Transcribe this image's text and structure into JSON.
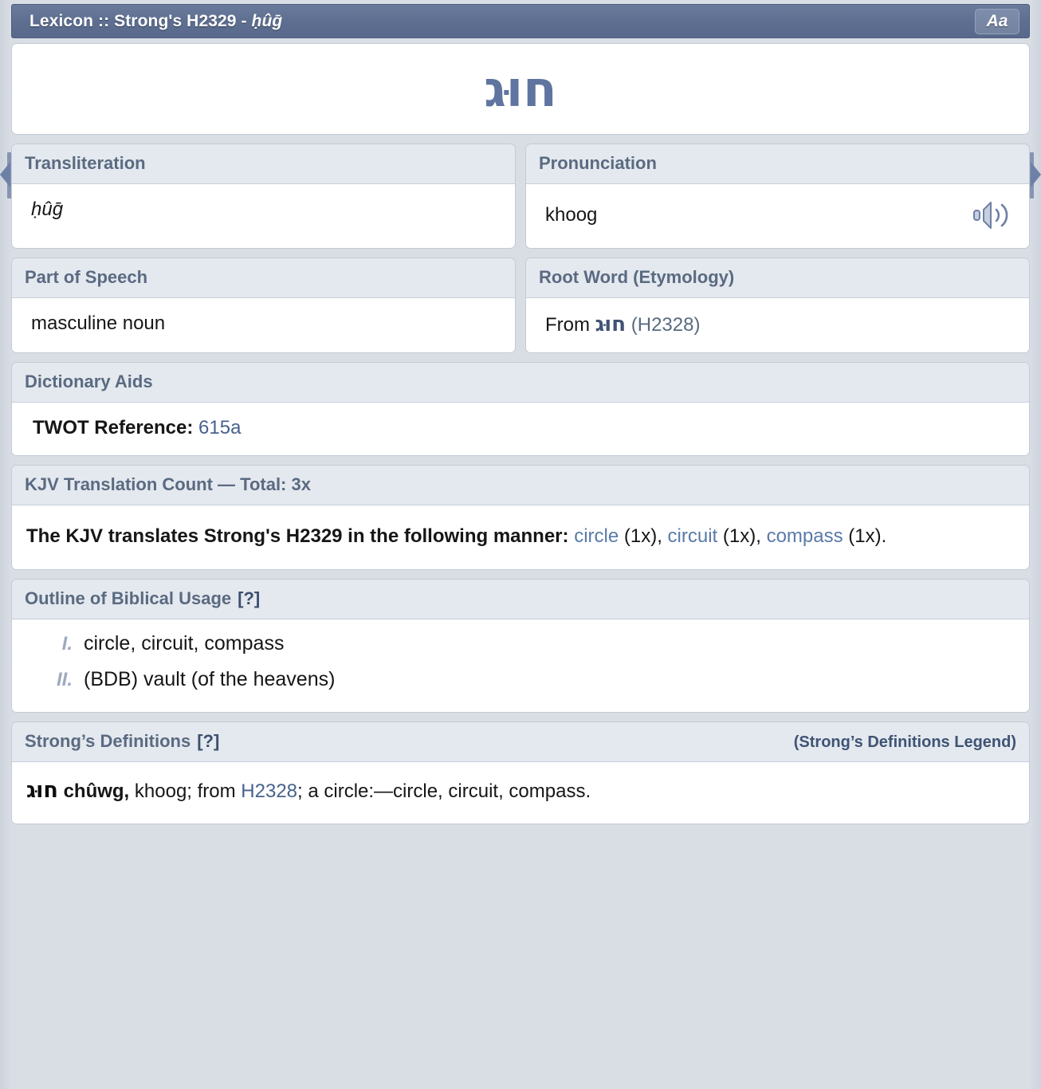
{
  "titlebar": {
    "title_plain": "Lexicon :: Strong's H2329 - ",
    "title_italic": "ḥûḡ",
    "font_button": "Aa"
  },
  "nav": {
    "prev_icon": "arrow-left-icon",
    "next_icon": "arrow-right-icon"
  },
  "hero": {
    "hebrew_word": "חוּג"
  },
  "transliteration": {
    "header": "Transliteration",
    "value": "ḥûḡ"
  },
  "pronunciation": {
    "header": "Pronunciation",
    "value": "khoog",
    "audio_icon": "speaker-icon"
  },
  "part_of_speech": {
    "header": "Part of Speech",
    "value": "masculine noun"
  },
  "root_word": {
    "header": "Root Word (Etymology)",
    "prefix": "From ",
    "hebrew": "חוּג",
    "reference": "(H2328)"
  },
  "dictionary_aids": {
    "header": "Dictionary Aids",
    "label": "TWOT Reference:",
    "value": "615a"
  },
  "kjv_count": {
    "header": "KJV Translation Count — Total: 3x",
    "lead": "The KJV translates Strong's H2329 in the following manner:",
    "entries": [
      {
        "word": "circle",
        "count": "(1x),"
      },
      {
        "word": "circuit",
        "count": "(1x),"
      },
      {
        "word": "compass",
        "count": "(1x)."
      }
    ]
  },
  "outline": {
    "header": "Outline of Biblical Usage",
    "help": "[?]",
    "items": [
      {
        "num": "I.",
        "text": "circle, circuit, compass"
      },
      {
        "num": "II.",
        "text": "(BDB) vault (of the heavens)"
      }
    ]
  },
  "strongs_definitions": {
    "header": "Strong’s Definitions",
    "help": "[?]",
    "legend": "(Strong’s Definitions Legend)",
    "hebrew": "חוּג",
    "transliteration": "chûwg,",
    "pronunciation": " khoog; from ",
    "ref_link": "H2328",
    "definition": "; a circle:—circle, circuit, compass."
  },
  "colors": {
    "titlebar": "#5e6f91",
    "header_text": "#5a6a81",
    "panel_header_bg": "#e4e9ef",
    "link": "#47628e",
    "hebrew_accent": "#5f759f",
    "page_bg": "#d9dee5"
  }
}
